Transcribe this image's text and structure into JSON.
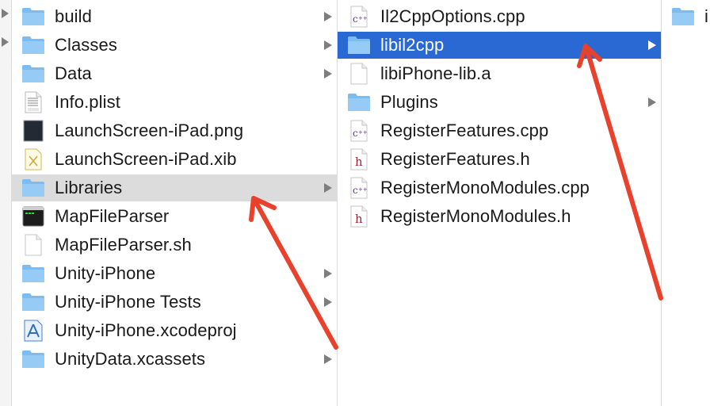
{
  "colors": {
    "folder": "#7cbcf0",
    "selection_blue": "#2a68d4",
    "selection_gray": "#dcdcdc",
    "annotation_arrow": "#e8412c"
  },
  "column1": {
    "items": [
      {
        "label": "build",
        "icon": "folder-icon",
        "has_children": true
      },
      {
        "label": "Classes",
        "icon": "folder-icon",
        "has_children": true
      },
      {
        "label": "Data",
        "icon": "folder-icon",
        "has_children": true
      },
      {
        "label": "Info.plist",
        "icon": "plist-file-icon",
        "has_children": false
      },
      {
        "label": "LaunchScreen-iPad.png",
        "icon": "png-image-icon",
        "has_children": false
      },
      {
        "label": "LaunchScreen-iPad.xib",
        "icon": "xib-file-icon",
        "has_children": false
      },
      {
        "label": "Libraries",
        "icon": "folder-icon",
        "has_children": true,
        "selected": true
      },
      {
        "label": "MapFileParser",
        "icon": "terminal-executable-icon",
        "has_children": false
      },
      {
        "label": "MapFileParser.sh",
        "icon": "document-icon",
        "has_children": false
      },
      {
        "label": "Unity-iPhone",
        "icon": "folder-icon",
        "has_children": true
      },
      {
        "label": "Unity-iPhone Tests",
        "icon": "folder-icon",
        "has_children": true
      },
      {
        "label": "Unity-iPhone.xcodeproj",
        "icon": "xcode-project-icon",
        "has_children": false
      },
      {
        "label": "UnityData.xcassets",
        "icon": "folder-icon",
        "has_children": true
      }
    ]
  },
  "column2": {
    "items": [
      {
        "label": "Il2CppOptions.cpp",
        "icon": "cpp-file-icon",
        "has_children": false
      },
      {
        "label": "libil2cpp",
        "icon": "folder-icon",
        "has_children": true,
        "selected": true
      },
      {
        "label": "libiPhone-lib.a",
        "icon": "document-icon",
        "has_children": false
      },
      {
        "label": "Plugins",
        "icon": "folder-icon",
        "has_children": true
      },
      {
        "label": "RegisterFeatures.cpp",
        "icon": "cpp-file-icon",
        "has_children": false
      },
      {
        "label": "RegisterFeatures.h",
        "icon": "header-file-icon",
        "has_children": false
      },
      {
        "label": "RegisterMonoModules.cpp",
        "icon": "cpp-file-icon",
        "has_children": false
      },
      {
        "label": "RegisterMonoModules.h",
        "icon": "header-file-icon",
        "has_children": false
      }
    ]
  },
  "column3": {
    "items": [
      {
        "label": "i",
        "icon": "folder-icon",
        "has_children": false
      }
    ]
  }
}
